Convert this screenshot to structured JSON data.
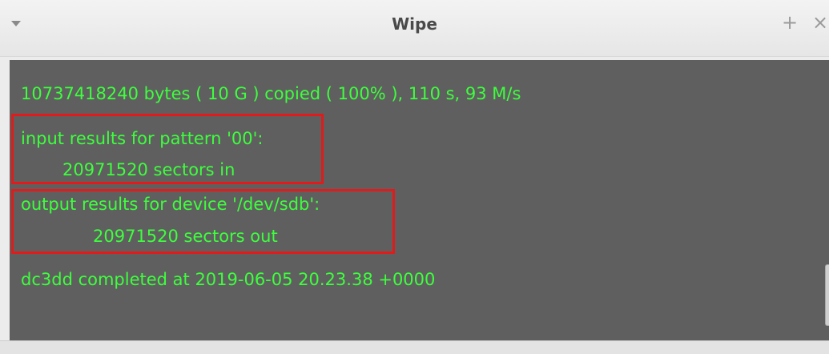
{
  "window": {
    "title": "Wipe",
    "menu_icon": "triangle-down-icon",
    "plus_label": "+",
    "close_label": "×"
  },
  "terminal": {
    "lines": [
      "10737418240 bytes ( 10 G ) copied ( 100% ), 110 s, 93 M/s",
      "input results for pattern '00':",
      "20971520 sectors in",
      "output results for device '/dev/sdb':",
      "20971520 sectors out",
      "dc3dd completed at 2019-06-05 20.23.38 +0000"
    ]
  },
  "colors": {
    "terminal_bg": "#5f5f5f",
    "terminal_text": "#3dff3d",
    "highlight_border": "#e11b1b"
  }
}
